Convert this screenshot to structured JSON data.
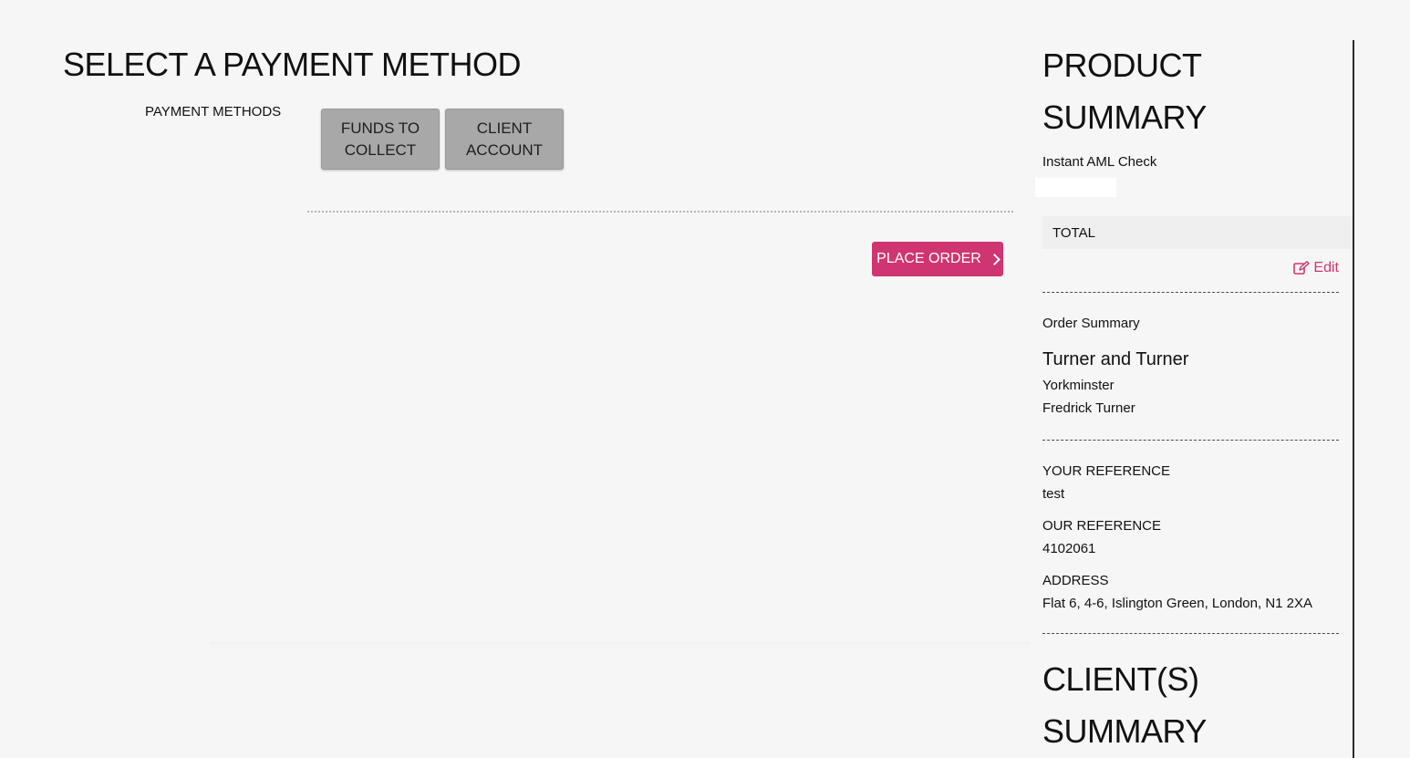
{
  "main": {
    "title": "SELECT A PAYMENT METHOD",
    "payment_methods_label": "PAYMENT METHODS",
    "payment_options": [
      {
        "label": "FUNDS TO COLLECT"
      },
      {
        "label": "CLIENT ACCOUNT"
      }
    ],
    "place_order_label": "PLACE ORDER",
    "place_order_icon": "chevron-right-icon",
    "accent_color": "#d03571"
  },
  "sidebar": {
    "product_summary_heading": "PRODUCT SUMMARY",
    "product_name": "Instant AML Check",
    "total_label": "TOTAL",
    "edit_label": "Edit",
    "edit_icon": "edit-icon",
    "order_summary_label": "Order Summary",
    "company_name": "Turner and Turner",
    "branch": "Yorkminster",
    "contact_name": "Fredrick Turner",
    "your_reference_label": "YOUR REFERENCE",
    "your_reference_value": "test",
    "our_reference_label": "OUR REFERENCE",
    "our_reference_value": "4102061",
    "address_label": "ADDRESS",
    "address_value": "Flat 6, 4-6, Islington Green, London, N1 2XA",
    "clients_summary_heading": "CLIENT(S) SUMMARY"
  }
}
